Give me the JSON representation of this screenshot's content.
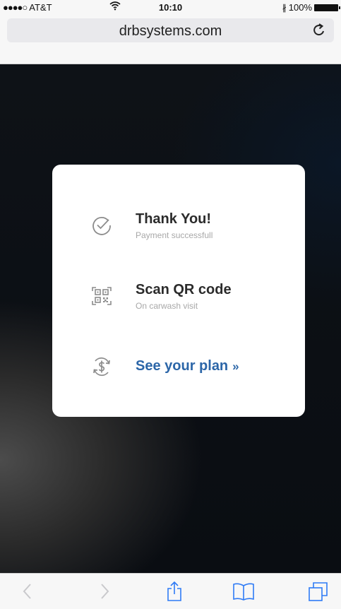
{
  "status_bar": {
    "signal": "●●●●○",
    "carrier": "AT&T",
    "wifi": "ᯤ",
    "time": "10:10",
    "bluetooth": "∦",
    "battery": "100%"
  },
  "browser": {
    "url": "drbsystems.com",
    "reload_icon": "reload-icon"
  },
  "card": {
    "rows": [
      {
        "icon": "check-circle-icon",
        "title": "Thank You!",
        "subtitle": "Payment successfull"
      },
      {
        "icon": "qr-code-icon",
        "title": "Scan QR code",
        "subtitle": "On carwash visit"
      }
    ],
    "plan_link": {
      "icon": "dollar-refresh-icon",
      "label": "See your plan",
      "chevron": "»"
    }
  },
  "toolbar": {
    "items": [
      "back-icon",
      "forward-icon",
      "share-icon",
      "bookmarks-icon",
      "tabs-icon"
    ]
  },
  "colors": {
    "link": "#2c66a8",
    "title": "#2b2b2b",
    "subtitle": "#a8a8a8",
    "icon_gray": "#8c8c8c"
  }
}
